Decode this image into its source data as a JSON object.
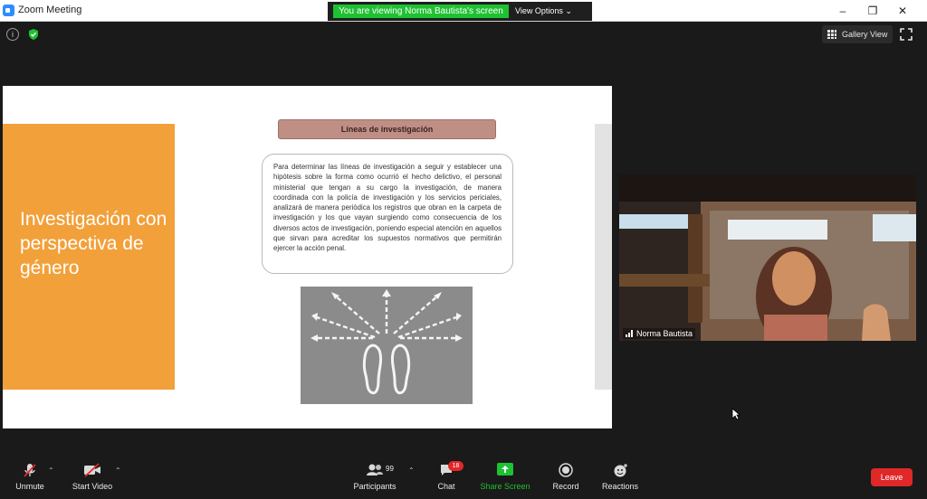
{
  "window": {
    "title": "Zoom Meeting",
    "controls": {
      "minimize": "–",
      "maximize": "❐",
      "close": "✕"
    }
  },
  "share_banner": {
    "text": "You are viewing Norma Bautista's screen",
    "view_options": "View Options ⌄",
    "color": "#1ec131"
  },
  "top_bar": {
    "info_icon": "info-icon",
    "security_icon": "shield-icon",
    "gallery_view": "Gallery View",
    "fullscreen_icon": "fullscreen-icon"
  },
  "slide": {
    "heading": "Líneas de investigación",
    "title": "Investigación con perspectiva de género",
    "body": "Para determinar las líneas de investigación a seguir y establecer una hipótesis sobre la forma como ocurrió el hecho delictivo, el personal ministerial que tengan a su cargo la investigación, de manera coordinada con la policía de investigación y los servicios periciales, analizará de manera periódica los registros que obran en la carpeta de investigación y los que vayan surgiendo como consecuencia de los diversos actos de investigación, poniendo especial atención en aquellos que sirvan para acreditar los supuestos normativos que permitirán ejercer la acción penal.",
    "image": "footprints-arrows-image",
    "accent_color": "#f2a03a"
  },
  "participant_video": {
    "name": "Norma Bautista"
  },
  "toolbar": {
    "unmute": "Unmute",
    "start_video": "Start Video",
    "participants": "Participants",
    "participants_count": "99",
    "chat": "Chat",
    "chat_badge": "18",
    "share_screen": "Share Screen",
    "record": "Record",
    "reactions": "Reactions",
    "leave": "Leave",
    "caret": "⌃",
    "share_color": "#1ec131",
    "leave_color": "#e02828"
  }
}
